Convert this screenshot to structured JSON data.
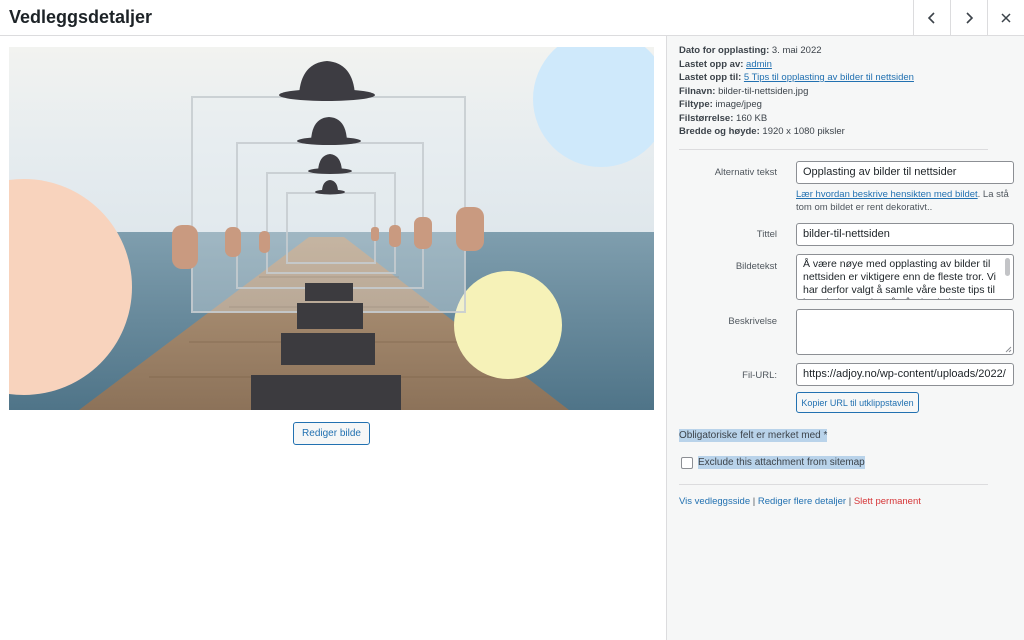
{
  "header": {
    "title": "Vedleggsdetaljer",
    "prev_icon": "chevron-left-icon",
    "next_icon": "chevron-right-icon",
    "close_icon": "close-icon"
  },
  "media": {
    "edit_button": "Rediger bilde"
  },
  "details": {
    "uploaded_on_label": "Dato for opplasting:",
    "uploaded_on_value": "3. mai 2022",
    "uploaded_by_label": "Lastet opp av:",
    "uploaded_by_value": "admin",
    "uploaded_to_label": "Lastet opp til:",
    "uploaded_to_value": "5 Tips til opplasting av bilder til nettsiden",
    "filename_label": "Filnavn:",
    "filename_value": "bilder-til-nettsiden.jpg",
    "filetype_label": "Filtype:",
    "filetype_value": "image/jpeg",
    "filesize_label": "Filstørrelse:",
    "filesize_value": "160 KB",
    "dimensions_label": "Bredde og høyde:",
    "dimensions_value": "1920 x 1080 piksler"
  },
  "fields": {
    "alt_label": "Alternativ tekst",
    "alt_value": "Opplasting av bilder til nettsider",
    "alt_help_link": "Lær hvordan beskrive hensikten med bildet",
    "alt_help_text": ". La stå tom om bildet er rent dekorativt..",
    "title_label": "Tittel",
    "title_value": "bilder-til-nettsiden",
    "caption_label": "Bildetekst",
    "caption_value": "Å være nøye med opplasting av bilder til nettsiden er viktigere enn de fleste tror. Vi har derfor valgt å samle våre beste tips til hva du bør tenke på når du skal",
    "description_label": "Beskrivelse",
    "description_value": "",
    "url_label": "Fil-URL:",
    "url_value": "https://adjoy.no/wp-content/uploads/2022/",
    "copy_button": "Kopier URL til utklippstavlen"
  },
  "footer": {
    "required_note": "Obligatoriske felt er merket med *",
    "exclude_label": "Exclude this attachment from sitemap",
    "exclude_checked": false,
    "view_link": "Vis vedleggsside",
    "sep1": "|",
    "edit_link": "Rediger flere detaljer",
    "sep2": "|",
    "delete_link": "Slett permanent"
  },
  "colors": {
    "link": "#2271b1",
    "danger": "#d63638",
    "sidebar_bg": "#f6f7f7",
    "highlight": "#b9d3ea"
  }
}
